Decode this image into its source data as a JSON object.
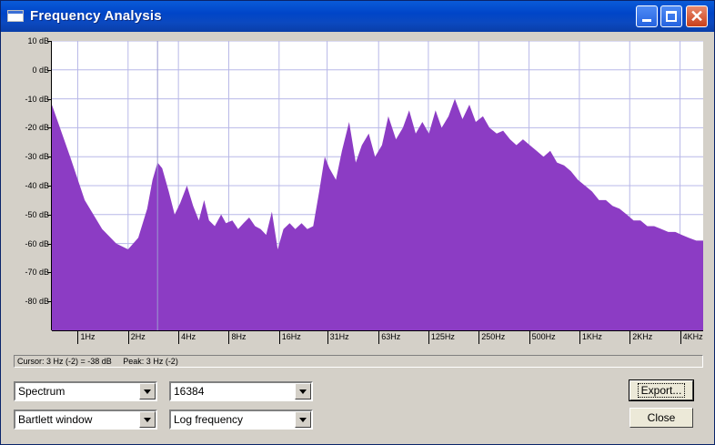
{
  "window": {
    "title": "Frequency Analysis"
  },
  "titlebar_buttons": {
    "minimize": "minimize",
    "maximize": "maximize",
    "close": "✕"
  },
  "axis": {
    "y_ticks": [
      "10 dB",
      "0 dB",
      "-10 dB",
      "-20 dB",
      "-30 dB",
      "-40 dB",
      "-50 dB",
      "-60 dB",
      "-70 dB",
      "-80 dB"
    ],
    "x_ticks": [
      "1Hz",
      "2Hz",
      "4Hz",
      "8Hz",
      "16Hz",
      "31Hz",
      "63Hz",
      "125Hz",
      "250Hz",
      "500Hz",
      "1KHz",
      "2KHz",
      "4KHz"
    ]
  },
  "status": {
    "cursor": "Cursor: 3 Hz (-2) = -38 dB",
    "peak": "Peak: 3 Hz (-2)"
  },
  "controls": {
    "algorithm": "Spectrum",
    "size": "16384",
    "window_func": "Bartlett window",
    "axis_mode": "Log frequency",
    "export_label": "Export...",
    "close_label": "Close"
  },
  "colors": {
    "spectrum_fill": "#8c3cc4",
    "grid": "#b8b8e8"
  },
  "chart_data": {
    "type": "area",
    "xlabel": "",
    "ylabel": "",
    "x_scale": "log2",
    "xlim_hz": [
      0.7,
      5500
    ],
    "ylim_db": [
      -90,
      10
    ],
    "cursor_hz": 3,
    "x_hz": [
      0.7,
      0.9,
      1.1,
      1.4,
      1.7,
      2.0,
      2.3,
      2.6,
      2.8,
      3.0,
      3.2,
      3.5,
      3.8,
      4.1,
      4.5,
      4.9,
      5.3,
      5.7,
      6.1,
      6.6,
      7.2,
      7.7,
      8.4,
      9.1,
      9.8,
      10.6,
      11.5,
      12.4,
      13.4,
      14.5,
      15.7,
      17,
      18.5,
      20,
      21.8,
      23.6,
      25.6,
      27.8,
      30,
      32,
      35,
      38,
      42,
      46,
      50,
      55,
      60,
      66,
      72,
      80,
      88,
      96,
      105,
      115,
      126,
      138,
      150,
      165,
      180,
      200,
      220,
      240,
      265,
      290,
      320,
      350,
      385,
      420,
      460,
      505,
      555,
      610,
      670,
      735,
      810,
      890,
      980,
      1080,
      1190,
      1310,
      1440,
      1580,
      1740,
      1920,
      2110,
      2320,
      2550,
      2800,
      3100,
      3400,
      3750,
      4100,
      4500,
      5000,
      5500
    ],
    "y_db": [
      -12,
      -30,
      -45,
      -55,
      -60,
      -62,
      -58,
      -48,
      -38,
      -32,
      -34,
      -42,
      -50,
      -46,
      -40,
      -47,
      -52,
      -45,
      -52,
      -54,
      -50,
      -53,
      -52,
      -55,
      -53,
      -51,
      -54,
      -55,
      -57,
      -49,
      -62,
      -55,
      -53,
      -55,
      -53,
      -55,
      -54,
      -42,
      -30,
      -34,
      -38,
      -28,
      -18,
      -32,
      -26,
      -22,
      -30,
      -26,
      -16,
      -24,
      -20,
      -14,
      -22,
      -18,
      -22,
      -14,
      -20,
      -16,
      -10,
      -17,
      -12,
      -18,
      -16,
      -20,
      -22,
      -21,
      -24,
      -26,
      -24,
      -26,
      -28,
      -30,
      -28,
      -32,
      -33,
      -35,
      -38,
      -40,
      -42,
      -45,
      -45,
      -47,
      -48,
      -50,
      -52,
      -52,
      -54,
      -54,
      -55,
      -56,
      -56,
      -57,
      -58,
      -59,
      -59
    ]
  }
}
